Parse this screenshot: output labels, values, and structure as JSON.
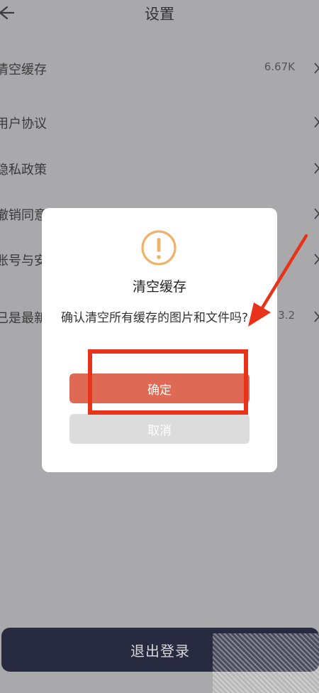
{
  "header": {
    "title": "设置",
    "back_icon": "back-arrow-icon"
  },
  "settings": {
    "items": [
      {
        "label": "清空缓存",
        "value": "6.67K"
      },
      {
        "label": "用户协议"
      },
      {
        "label": "隐私政策"
      },
      {
        "label": "撤销同意"
      },
      {
        "label": "账号与安"
      },
      {
        "label": "已是最新",
        "value": "3.2"
      }
    ]
  },
  "dialog": {
    "icon": "warning-icon",
    "title": "清空缓存",
    "message": "确认清空所有缓存的图片和文件吗?",
    "confirm_label": "确定",
    "cancel_label": "取消"
  },
  "footer": {
    "logout_label": "退出登录"
  },
  "colors": {
    "overlay_bg": "#a9a9ab",
    "accent": "#de6a55",
    "warning_icon": "#f0b26a",
    "logout_bg": "#282a40",
    "annotation": "#e8321a"
  }
}
